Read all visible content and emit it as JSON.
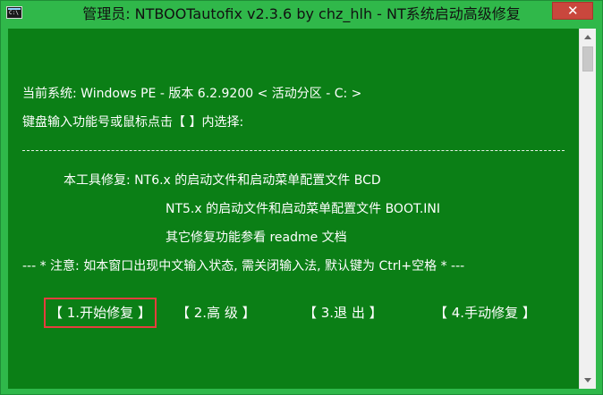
{
  "window": {
    "title": "管理员: NTBOOTautofix v2.3.6 by chz_hlh - NT系统启动高级修复",
    "app_icon": "console-window-icon",
    "app_icon_text": "C:\\",
    "close_icon": "close-icon",
    "close_label": "✕"
  },
  "console": {
    "system_info": "当前系统: Windows PE - 版本 6.2.9200  < 活动分区 - C: >",
    "prompt": "键盘输入功能号或鼠标点击【 】内选择:",
    "tool_line1": "本工具修复:   NT6.x 的启动文件和启动菜单配置文件 BCD",
    "tool_line2": "NT5.x 的启动文件和启动菜单配置文件 BOOT.INI",
    "tool_line3": "其它修复功能参看 readme 文档",
    "note": "--- * 注意: 如本窗口出现中文输入状态, 需关闭输入法, 默认键为 Ctrl+空格 * ---"
  },
  "menu": {
    "items": [
      {
        "label": "【 1.开始修复 】",
        "selected": true
      },
      {
        "label": "【  2.高   级  】",
        "selected": false
      },
      {
        "label": "【  3.退   出  】",
        "selected": false
      },
      {
        "label": "【 4.手动修复 】",
        "selected": false
      }
    ]
  },
  "scrollbar": {
    "up_icon": "scroll-up-icon",
    "down_icon": "scroll-down-icon"
  },
  "colors": {
    "titlebar": "#30b84a",
    "console_background": "#0b7f16",
    "text": "#ffffff",
    "selection_border": "#e63e3e",
    "close_button": "#c9473d"
  }
}
